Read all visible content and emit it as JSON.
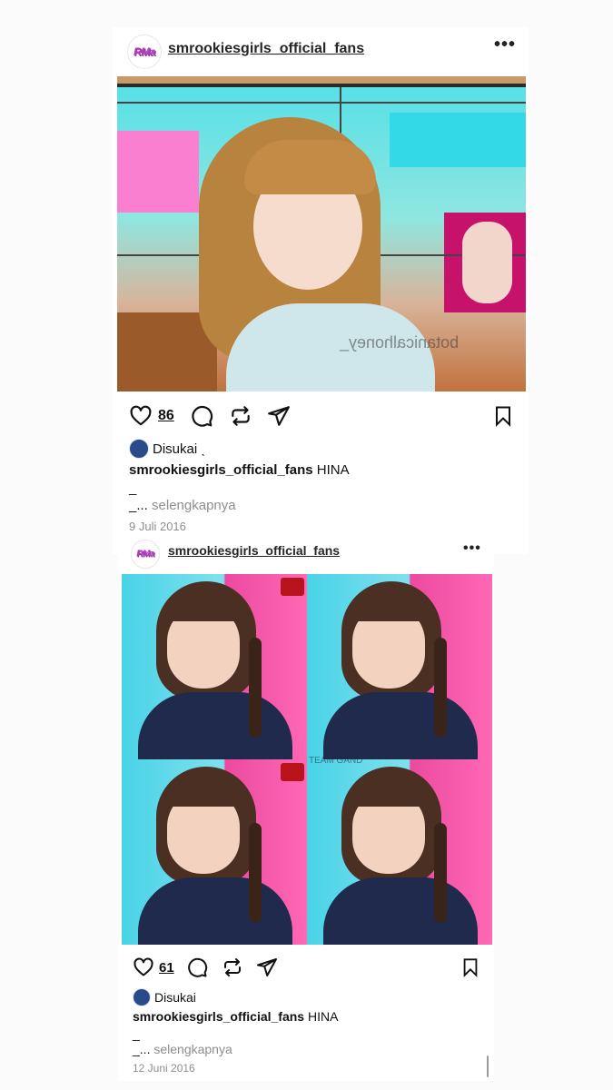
{
  "posts": [
    {
      "username": "smrookiesgirls_official_fans",
      "avatar_text": "RMa",
      "likes": "86",
      "liked_by": "Disukai ˎ",
      "caption_user": "smrookiesgirls_official_fans",
      "caption_text": "HINA",
      "caption_line2": "_",
      "caption_line3": "_...",
      "more_label": "selengkapnya",
      "date": "9 Juli 2016",
      "watermark": "botanicalhoney_"
    },
    {
      "username": "smrookiesgirls_official_fans",
      "avatar_text": "RMa",
      "likes": "61",
      "liked_by": "Disukai",
      "caption_user": "smrookiesgirls_official_fans",
      "caption_text": "HINA",
      "caption_line2": "_",
      "caption_line3": "_...",
      "more_label": "selengkapnya",
      "date": "12 Juni 2016",
      "watermark": "TEAM GAND"
    }
  ],
  "icons": {
    "more": "more-horizontal-icon",
    "like": "heart-icon",
    "comment": "comment-icon",
    "repost": "repost-icon",
    "share": "send-icon",
    "save": "bookmark-icon"
  },
  "colors": {
    "text": "#111111",
    "secondary": "#8e8e8e",
    "background": "#fbfbfb"
  }
}
